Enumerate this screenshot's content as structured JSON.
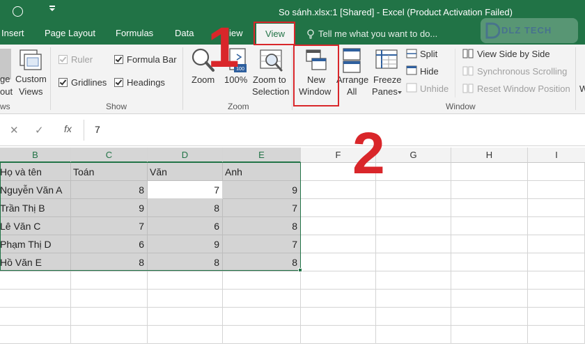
{
  "titlebar": {
    "title": "So sánh.xlsx:1  [Shared] - Excel (Product Activation Failed)"
  },
  "tabs": {
    "insert": "Insert",
    "page_layout": "Page Layout",
    "formulas": "Formulas",
    "data": "Data",
    "review_partial": "iew",
    "view": "View",
    "tell_me": "Tell me what you want to do..."
  },
  "logo": {
    "text": "DLZ TECH"
  },
  "ribbon": {
    "workbook_views": {
      "page_layout_partial_1": "ge",
      "page_layout_partial_2": "out",
      "custom_views_1": "Custom",
      "custom_views_2": "Views",
      "group_partial": "ws"
    },
    "show": {
      "ruler": "Ruler",
      "formula_bar": "Formula Bar",
      "gridlines": "Gridlines",
      "headings": "Headings",
      "group": "Show"
    },
    "zoom": {
      "zoom": "Zoom",
      "hundred": "100%",
      "zoom_to_selection_1": "Zoom to",
      "zoom_to_selection_2": "Selection",
      "group": "Zoom"
    },
    "window": {
      "new_window_1": "New",
      "new_window_2": "Window",
      "arrange_1": "Arrange",
      "arrange_2": "All",
      "freeze_1": "Freeze",
      "freeze_2": "Panes",
      "split": "Split",
      "hide": "Hide",
      "unhide": "Unhide",
      "view_side_by_side": "View Side by Side",
      "sync_scrolling": "Synchronous Scrolling",
      "reset_window_position": "Reset Window Position",
      "group": "Window",
      "partial_w": "W"
    }
  },
  "formula_bar": {
    "value": "7"
  },
  "columns": [
    "B",
    "C",
    "D",
    "E",
    "F",
    "G",
    "H",
    "I"
  ],
  "table": {
    "header": [
      "Họ và tên",
      "Toán",
      "Văn",
      "Anh"
    ],
    "rows": [
      [
        "Nguyễn Văn A",
        "8",
        "7",
        "9"
      ],
      [
        "Trần Thị B",
        "9",
        "8",
        "7"
      ],
      [
        "Lê Văn C",
        "7",
        "6",
        "8"
      ],
      [
        "Phạm Thị D",
        "6",
        "9",
        "7"
      ],
      [
        "Hồ Văn E",
        "8",
        "8",
        "8"
      ]
    ]
  },
  "annotations": {
    "step1": "1",
    "step2": "2",
    "highlight_color": "#d9262a"
  },
  "colors": {
    "excel_green": "#217346",
    "ribbon_bg": "#f3f3f3",
    "selection_gray": "#d4d4d4"
  }
}
